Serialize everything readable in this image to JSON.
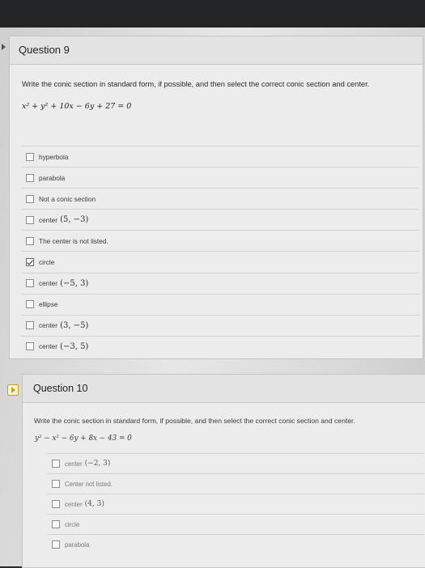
{
  "question9": {
    "title": "Question 9",
    "prompt": "Write the conic section in standard form, if possible, and then select the correct conic section and center.",
    "equation": "x² + y² + 10x − 6y + 27 = 0",
    "answers": [
      {
        "label": "hyperbola",
        "math": "",
        "checked": false
      },
      {
        "label": "parabola",
        "math": "",
        "checked": false
      },
      {
        "label": "Not a conic section",
        "math": "",
        "checked": false
      },
      {
        "label": "center",
        "math": "(5, −3)",
        "checked": false
      },
      {
        "label": "The center is not listed.",
        "math": "",
        "checked": false
      },
      {
        "label": "circle",
        "math": "",
        "checked": true
      },
      {
        "label": "center",
        "math": "(−5, 3)",
        "checked": false
      },
      {
        "label": "ellipse",
        "math": "",
        "checked": false
      },
      {
        "label": "center",
        "math": "(3, −5)",
        "checked": false
      },
      {
        "label": "center",
        "math": "(−3, 5)",
        "checked": false
      }
    ]
  },
  "question10": {
    "title": "Question 10",
    "prompt": "Write the conic section in standard form, if possible, and then select the correct conic section and center.",
    "equation": "y² − x² − 6y + 8x − 43 = 0",
    "answers": [
      {
        "label": "center",
        "math": "(−2, 3)",
        "checked": false
      },
      {
        "label": "Center not listed.",
        "math": "",
        "checked": false
      },
      {
        "label": "center",
        "math": "(4, 3)",
        "checked": false
      },
      {
        "label": "circle",
        "math": "",
        "checked": false
      },
      {
        "label": "parabola",
        "math": "",
        "checked": false
      }
    ]
  }
}
